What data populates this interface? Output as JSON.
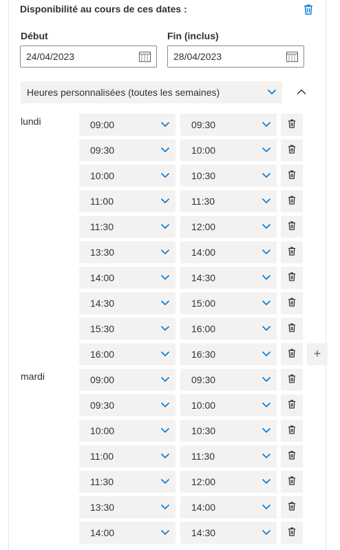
{
  "header": {
    "title": "Disponibilité au cours de ces dates :"
  },
  "dates": {
    "start_label": "Début",
    "start_value": "24/04/2023",
    "end_label": "Fin (inclus)",
    "end_value": "28/04/2023"
  },
  "recurrence": {
    "selected": "Heures personnalisées (toutes les semaines)"
  },
  "days": [
    {
      "name": "lundi",
      "slots": [
        {
          "from": "09:00",
          "to": "09:30"
        },
        {
          "from": "09:30",
          "to": "10:00"
        },
        {
          "from": "10:00",
          "to": "10:30"
        },
        {
          "from": "11:00",
          "to": "11:30"
        },
        {
          "from": "11:30",
          "to": "12:00"
        },
        {
          "from": "13:30",
          "to": "14:00"
        },
        {
          "from": "14:00",
          "to": "14:30"
        },
        {
          "from": "14:30",
          "to": "15:00"
        },
        {
          "from": "15:30",
          "to": "16:00"
        },
        {
          "from": "16:00",
          "to": "16:30"
        }
      ],
      "add_label": "+"
    },
    {
      "name": "mardi",
      "slots": [
        {
          "from": "09:00",
          "to": "09:30"
        },
        {
          "from": "09:30",
          "to": "10:00"
        },
        {
          "from": "10:00",
          "to": "10:30"
        },
        {
          "from": "11:00",
          "to": "11:30"
        },
        {
          "from": "11:30",
          "to": "12:00"
        },
        {
          "from": "13:30",
          "to": "14:00"
        },
        {
          "from": "14:00",
          "to": "14:30"
        }
      ]
    }
  ],
  "colors": {
    "accent": "#0078d4",
    "field_bg": "#f3f2f1",
    "text": "#323130"
  }
}
